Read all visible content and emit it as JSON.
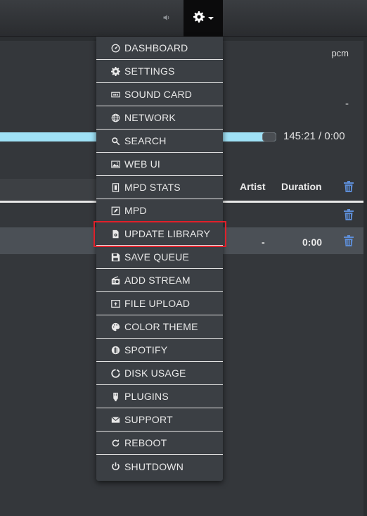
{
  "topbar": {
    "volume_icon": "speaker-icon",
    "settings_icon": "gear-icon"
  },
  "player": {
    "output": "pcm",
    "status_right": "-",
    "time": "145:21 / 0:00",
    "progress_fraction": 0.98
  },
  "queue": {
    "headers": {
      "artist": "Artist",
      "duration": "Duration"
    },
    "rows": [
      {
        "artist": "-",
        "duration": "0:00",
        "selected": true
      }
    ]
  },
  "menu": {
    "items": [
      {
        "label": "DASHBOARD",
        "icon": "dashboard-icon"
      },
      {
        "label": "SETTINGS",
        "icon": "gear-icon"
      },
      {
        "label": "SOUND CARD",
        "icon": "soundcard-icon"
      },
      {
        "label": "NETWORK",
        "icon": "globe-icon"
      },
      {
        "label": "SEARCH",
        "icon": "search-icon"
      },
      {
        "label": "WEB UI",
        "icon": "image-icon"
      },
      {
        "label": "MPD STATS",
        "icon": "stats-icon"
      },
      {
        "label": "MPD",
        "icon": "edit-icon"
      },
      {
        "label": "UPDATE LIBRARY",
        "icon": "database-icon",
        "highlighted": true
      },
      {
        "label": "SAVE QUEUE",
        "icon": "save-icon"
      },
      {
        "label": "ADD STREAM",
        "icon": "radio-icon"
      },
      {
        "label": "FILE UPLOAD",
        "icon": "upload-icon"
      },
      {
        "label": "COLOR THEME",
        "icon": "palette-icon"
      },
      {
        "label": "SPOTIFY",
        "icon": "spotify-icon"
      },
      {
        "label": "DISK USAGE",
        "icon": "disk-usage-icon"
      },
      {
        "label": "PLUGINS",
        "icon": "plug-icon"
      },
      {
        "label": "SUPPORT",
        "icon": "envelope-icon"
      },
      {
        "label": "REBOOT",
        "icon": "refresh-icon"
      },
      {
        "label": "SHUTDOWN",
        "icon": "power-icon"
      }
    ]
  },
  "colors": {
    "highlight": "#e0202a",
    "progress": "#9fe1f6",
    "trash": "#5d8dd6"
  }
}
